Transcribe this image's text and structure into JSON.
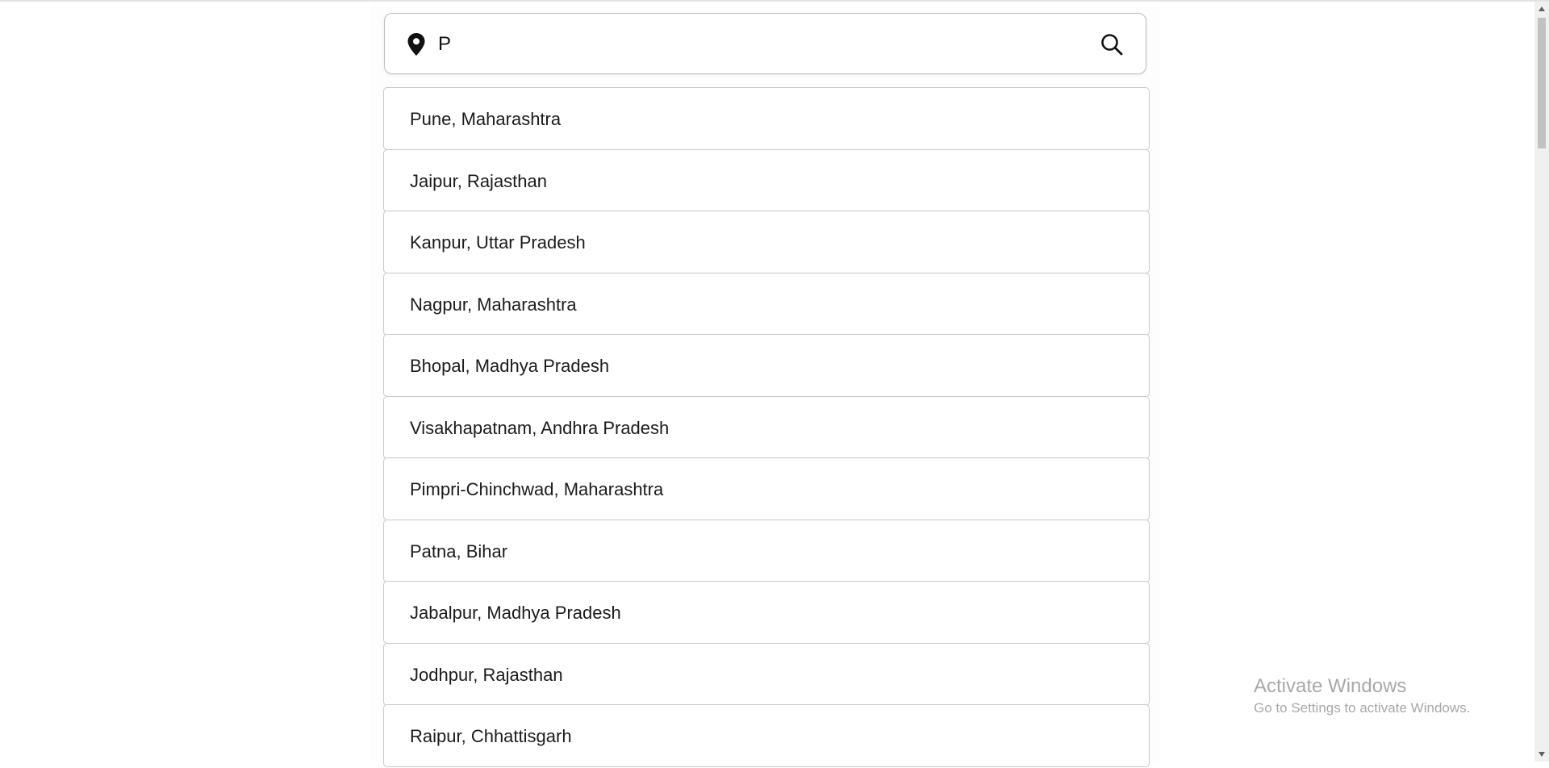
{
  "search": {
    "value": "P",
    "location_icon": "map-pin-icon",
    "search_icon": "search-icon"
  },
  "results": [
    "Pune, Maharashtra",
    "Jaipur, Rajasthan",
    "Kanpur, Uttar Pradesh",
    "Nagpur, Maharashtra",
    "Bhopal, Madhya Pradesh",
    "Visakhapatnam, Andhra Pradesh",
    "Pimpri-Chinchwad, Maharashtra",
    "Patna, Bihar",
    "Jabalpur, Madhya Pradesh",
    "Jodhpur, Rajasthan",
    "Raipur, Chhattisgarh"
  ],
  "watermark": {
    "title": "Activate Windows",
    "subtitle": "Go to Settings to activate Windows."
  },
  "colors": {
    "border": "#c9c9c9",
    "text": "#1b1b1b",
    "watermark": "#a8a8a8"
  }
}
